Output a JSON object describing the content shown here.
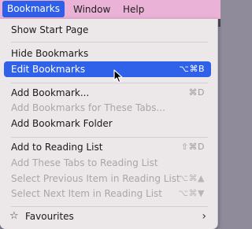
{
  "menubar": {
    "items": [
      {
        "label": "Bookmarks",
        "active": true
      },
      {
        "label": "Window",
        "active": false
      },
      {
        "label": "Help",
        "active": false
      }
    ]
  },
  "menu": {
    "items": [
      {
        "label": "Show Start Page",
        "shortcut": "",
        "enabled": true
      },
      {
        "label": "Hide Bookmarks",
        "shortcut": "",
        "enabled": true
      },
      {
        "label": "Edit Bookmarks",
        "shortcut": "⌥⌘B",
        "enabled": true,
        "highlighted": true
      },
      {
        "label": "Add Bookmark...",
        "shortcut": "⌘D",
        "enabled": true
      },
      {
        "label": "Add Bookmarks for These Tabs...",
        "shortcut": "",
        "enabled": false
      },
      {
        "label": "Add Bookmark Folder",
        "shortcut": "",
        "enabled": true
      },
      {
        "label": "Add to Reading List",
        "shortcut": "⇧⌘D",
        "enabled": true
      },
      {
        "label": "Add These Tabs to Reading List",
        "shortcut": "",
        "enabled": false
      },
      {
        "label": "Select Previous Item in Reading List",
        "shortcut": "⌥⌘▲",
        "enabled": false
      },
      {
        "label": "Select Next Item in Reading List",
        "shortcut": "⌥⌘▼",
        "enabled": false
      },
      {
        "label": "Favourites",
        "shortcut": "",
        "enabled": true,
        "submenu": true,
        "icon": "star-icon"
      }
    ]
  },
  "colors": {
    "menubar_bg": "#e9b2d6",
    "highlight": "#2f62e9",
    "menu_bg": "#ece8ea",
    "disabled_text": "#a9a5a8"
  }
}
